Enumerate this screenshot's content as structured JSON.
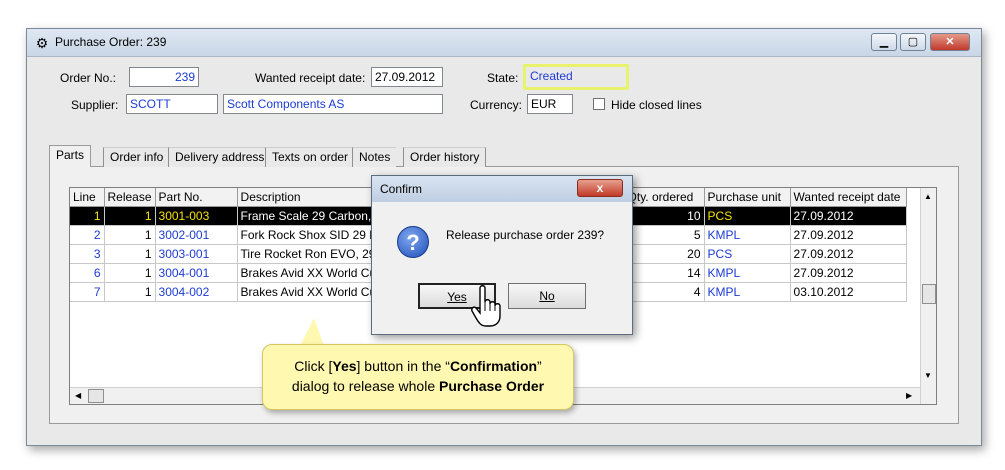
{
  "window": {
    "title": "Purchase Order: 239",
    "icon": "gear-icon"
  },
  "header": {
    "order_no_label": "Order No.:",
    "order_no": "239",
    "wanted_date_label": "Wanted receipt date:",
    "wanted_date": "27.09.2012",
    "state_label": "State:",
    "state": "Created",
    "supplier_label": "Supplier:",
    "supplier_code": "SCOTT",
    "supplier_name": "Scott Components AS",
    "currency_label": "Currency:",
    "currency": "EUR",
    "hide_closed_label": "Hide closed lines"
  },
  "tabs": [
    "Parts",
    "Order info",
    "Delivery address",
    "Texts on order",
    "Notes",
    "Order history"
  ],
  "grid": {
    "columns": [
      "Line",
      "Release",
      "Part No.",
      "Description",
      "Qty. ordered",
      "Purchase unit",
      "Wanted receipt date"
    ],
    "rows": [
      {
        "line": "1",
        "release": "1",
        "part": "3001-003",
        "desc": "Frame Scale 29 Carbon, I",
        "qty": "10",
        "unit": "PCS",
        "date": "27.09.2012"
      },
      {
        "line": "2",
        "release": "1",
        "part": "3002-001",
        "desc": "Fork Rock Shox SID 29 F",
        "qty": "5",
        "unit": "KMPL",
        "date": "27.09.2012"
      },
      {
        "line": "3",
        "release": "1",
        "part": "3003-001",
        "desc": "Tire Rocket Ron EVO, 29",
        "qty": "20",
        "unit": "PCS",
        "date": "27.09.2012"
      },
      {
        "line": "6",
        "release": "1",
        "part": "3004-001",
        "desc": "Brakes Avid XX World Cu",
        "qty": "14",
        "unit": "KMPL",
        "date": "27.09.2012"
      },
      {
        "line": "7",
        "release": "1",
        "part": "3004-002",
        "desc": "Brakes Avid XX World Cu",
        "qty": "4",
        "unit": "KMPL",
        "date": "03.10.2012"
      }
    ]
  },
  "dialog": {
    "title": "Confirm",
    "close": "x",
    "message": "Release purchase order 239?",
    "yes": "Yes",
    "no": "No"
  },
  "callout": {
    "line1_a": "Click [",
    "line1_b": "Yes",
    "line1_c": "] button in the “",
    "line1_d": "Confirmation",
    "line1_e": "”",
    "line2_a": "dialog to release whole ",
    "line2_b": "Purchase Order"
  },
  "colors": {
    "highlight": "#e9f26b",
    "link_blue": "#1d3bd6",
    "selected_yellow": "#f7e300",
    "callout_bg": "#fff8b0"
  }
}
